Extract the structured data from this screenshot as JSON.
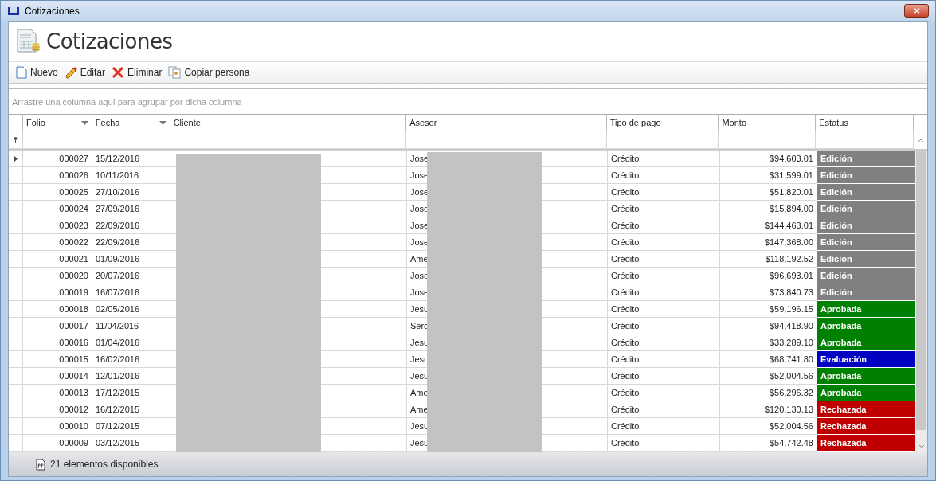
{
  "window": {
    "title": "Cotizaciones",
    "close": "✕"
  },
  "header": {
    "title": "Cotizaciones"
  },
  "toolbar": [
    {
      "kind": "new",
      "label": "Nuevo"
    },
    {
      "kind": "edit",
      "label": "Editar"
    },
    {
      "kind": "delete",
      "label": "Eliminar"
    },
    {
      "kind": "copy",
      "label": "Copiar persona"
    }
  ],
  "group_panel": {
    "placeholder": "Arrastre una columna aquí para agrupar por dicha columna"
  },
  "table": {
    "columns": [
      {
        "label": "Folio",
        "filter": true
      },
      {
        "label": "Fecha",
        "filter": true
      },
      {
        "label": "Cliente",
        "filter": false
      },
      {
        "label": "Asesor",
        "filter": false
      },
      {
        "label": "Tipo de pago",
        "filter": false
      },
      {
        "label": "Monto",
        "filter": false
      },
      {
        "label": "Estatus",
        "filter": false
      }
    ],
    "rows": [
      {
        "folio": "000027",
        "fecha": "15/12/2016",
        "asesor": "Jose",
        "tipo": "Crédito",
        "monto": "$94,603.01",
        "estatus": "Edición",
        "color": "#808080",
        "selected": true
      },
      {
        "folio": "000026",
        "fecha": "10/11/2016",
        "asesor": "Jose",
        "tipo": "Crédito",
        "monto": "$31,599.01",
        "estatus": "Edición",
        "color": "#808080",
        "selected": false
      },
      {
        "folio": "000025",
        "fecha": "27/10/2016",
        "asesor": "Jose",
        "tipo": "Crédito",
        "monto": "$51,820.01",
        "estatus": "Edición",
        "color": "#808080",
        "selected": false
      },
      {
        "folio": "000024",
        "fecha": "27/09/2016",
        "asesor": "Jose",
        "tipo": "Crédito",
        "monto": "$15,894.00",
        "estatus": "Edición",
        "color": "#808080",
        "selected": false
      },
      {
        "folio": "000023",
        "fecha": "22/09/2016",
        "asesor": "Jose",
        "tipo": "Crédito",
        "monto": "$144,463.01",
        "estatus": "Edición",
        "color": "#808080",
        "selected": false
      },
      {
        "folio": "000022",
        "fecha": "22/09/2016",
        "asesor": "Jose",
        "tipo": "Crédito",
        "monto": "$147,368.00",
        "estatus": "Edición",
        "color": "#808080",
        "selected": false
      },
      {
        "folio": "000021",
        "fecha": "01/09/2016",
        "asesor": "Ame",
        "tipo": "Crédito",
        "monto": "$118,192.52",
        "estatus": "Edición",
        "color": "#808080",
        "selected": false
      },
      {
        "folio": "000020",
        "fecha": "20/07/2016",
        "asesor": "Jose",
        "tipo": "Crédito",
        "monto": "$96,693.01",
        "estatus": "Edición",
        "color": "#808080",
        "selected": false
      },
      {
        "folio": "000019",
        "fecha": "16/07/2016",
        "asesor": "Jose",
        "tipo": "Crédito",
        "monto": "$73,840.73",
        "estatus": "Edición",
        "color": "#808080",
        "selected": false
      },
      {
        "folio": "000018",
        "fecha": "02/05/2016",
        "asesor": "Jesu",
        "tipo": "Crédito",
        "monto": "$59,196.15",
        "estatus": "Aprobada",
        "color": "#008000",
        "selected": false
      },
      {
        "folio": "000017",
        "fecha": "11/04/2016",
        "asesor": "Serg",
        "tipo": "Crédito",
        "monto": "$94,418.90",
        "estatus": "Aprobada",
        "color": "#008000",
        "selected": false
      },
      {
        "folio": "000016",
        "fecha": "01/04/2016",
        "asesor": "Jesu",
        "tipo": "Crédito",
        "monto": "$33,289.10",
        "estatus": "Aprobada",
        "color": "#008000",
        "selected": false
      },
      {
        "folio": "000015",
        "fecha": "16/02/2016",
        "asesor": "Jesu",
        "tipo": "Crédito",
        "monto": "$68,741.80",
        "estatus": "Evaluación",
        "color": "#0000c0",
        "selected": false
      },
      {
        "folio": "000014",
        "fecha": "12/01/2016",
        "asesor": "Jesu",
        "tipo": "Crédito",
        "monto": "$52,004.56",
        "estatus": "Aprobada",
        "color": "#008000",
        "selected": false
      },
      {
        "folio": "000013",
        "fecha": "17/12/2015",
        "asesor": "Ame",
        "tipo": "Crédito",
        "monto": "$56,296.32",
        "estatus": "Aprobada",
        "color": "#008000",
        "selected": false
      },
      {
        "folio": "000012",
        "fecha": "16/12/2015",
        "asesor": "Ame",
        "tipo": "Crédito",
        "monto": "$120,130.13",
        "estatus": "Rechazada",
        "color": "#c00000",
        "selected": false
      },
      {
        "folio": "000010",
        "fecha": "07/12/2015",
        "asesor": "Jesu",
        "tipo": "Crédito",
        "monto": "$52,004.56",
        "estatus": "Rechazada",
        "color": "#c00000",
        "selected": false
      },
      {
        "folio": "000009",
        "fecha": "03/12/2015",
        "asesor": "Jesu",
        "tipo": "Crédito",
        "monto": "$54,742.48",
        "estatus": "Rechazada",
        "color": "#c00000",
        "selected": false
      }
    ]
  },
  "status_bar": {
    "count": "21 elementos disponibles"
  }
}
